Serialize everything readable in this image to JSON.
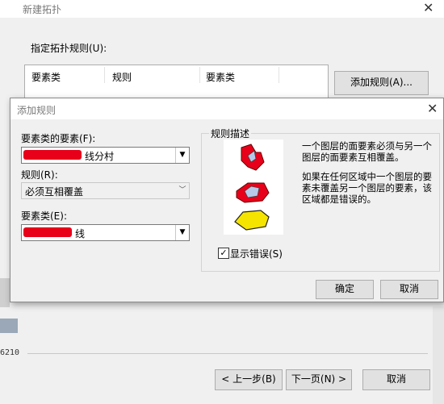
{
  "bg_window": {
    "title": "新建拓扑",
    "label": "指定拓扑规则(U):",
    "columns": [
      "要素类",
      "规则",
      "要素类"
    ],
    "add_button": "添加规则(A)...",
    "code_fragment": "6210",
    "back_button": "< 上一步(B)",
    "next_button": "下一页(N) >",
    "cancel_button": "取消"
  },
  "dialog": {
    "title": "添加规则",
    "feature_label": "要素类的要素(F):",
    "feature_value": "线分村",
    "rule_label": "规则(R):",
    "rule_value": "必须互相覆盖",
    "featureclass_label": "要素类(E):",
    "featureclass_value": "线",
    "desc_group_title": "规则描述",
    "desc_line1": "一个图层的面要素必须与另一个图层的面要素互相覆盖。",
    "desc_line2": "如果在任何区域中一个图层的要素未覆盖另一个图层的要素，该区域都是错误的。",
    "show_errors_label": "显示错误(S)",
    "show_errors_checked": "✓",
    "ok_button": "确定",
    "cancel_button": "取消"
  },
  "colors": {
    "error_red": "#e8001a",
    "yellow": "#f5e400",
    "light_blue": "#b8c8e8"
  }
}
